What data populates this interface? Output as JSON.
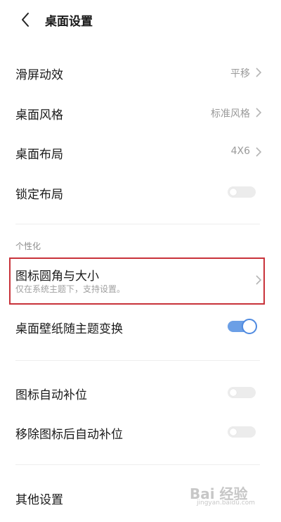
{
  "header": {
    "title": "桌面设置",
    "back_icon": "chevron-left-icon"
  },
  "settings": {
    "scroll_effect": {
      "label": "滑屏动效",
      "value": "平移"
    },
    "desktop_style": {
      "label": "桌面风格",
      "value": "标准风格"
    },
    "desktop_layout": {
      "label": "桌面布局",
      "value": "4X6"
    },
    "lock_layout": {
      "label": "锁定布局",
      "enabled": false
    }
  },
  "personalization": {
    "section_title": "个性化",
    "icon_corner_size": {
      "label": "图标圆角与大小",
      "subtitle": "仅在系统主题下，支持设置。"
    },
    "wallpaper_follow_theme": {
      "label": "桌面壁纸随主题变换",
      "enabled": true
    }
  },
  "auto_fill": {
    "icon_auto_fill": {
      "label": "图标自动补位",
      "enabled": false
    },
    "auto_fill_after_remove": {
      "label": "移除图标后自动补位",
      "enabled": false
    }
  },
  "other": {
    "label": "其他设置"
  },
  "watermark": {
    "logo": "Bai 经验",
    "url": "jingyan.baidu.com"
  },
  "colors": {
    "toggle_on": "#6b9fe6",
    "toggle_off": "#ececec",
    "highlight": "#c8323a"
  }
}
